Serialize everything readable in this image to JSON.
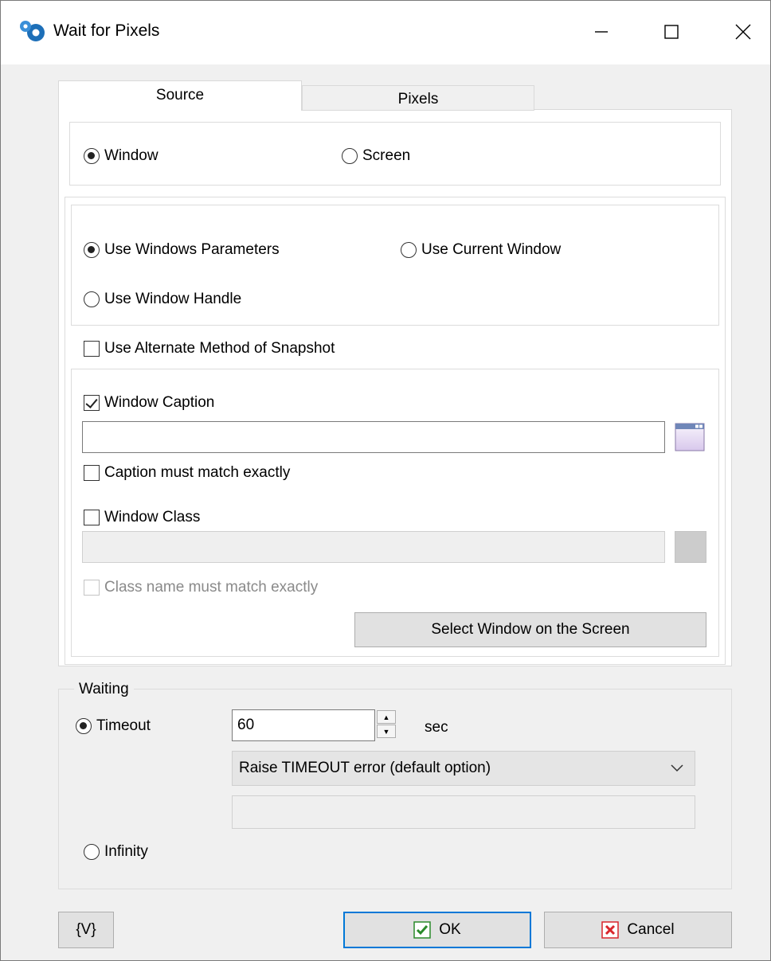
{
  "window": {
    "title": "Wait for Pixels",
    "icons": {
      "app": "app-gear-icon",
      "minimize": "minimize-icon",
      "maximize": "maximize-icon",
      "close": "close-icon"
    }
  },
  "tabs": [
    {
      "label": "Source",
      "active": true
    },
    {
      "label": "Pixels",
      "active": false
    }
  ],
  "source": {
    "window_radio": "Window",
    "screen_radio": "Screen",
    "use_windows_parameters": "Use Windows Parameters",
    "use_current_window": "Use Current Window",
    "use_window_handle": "Use Window Handle",
    "use_alternate_method": "Use Alternate Method of Snapshot",
    "window_caption": "Window Caption",
    "window_caption_value": "",
    "caption_match_exactly": "Caption must match exactly",
    "window_class": "Window Class",
    "window_class_value": "",
    "class_match_exactly": "Class name must match exactly",
    "select_window_button": "Select Window on the Screen"
  },
  "waiting": {
    "legend": "Waiting",
    "timeout_label": "Timeout",
    "timeout_value": "60",
    "unit": "sec",
    "timeout_action": "Raise TIMEOUT error (default option)",
    "extra_value": "",
    "infinity_label": "Infinity"
  },
  "footer": {
    "variables_button": "{V}",
    "ok_button": "OK",
    "cancel_button": "Cancel"
  },
  "colors": {
    "accent": "#0078d7",
    "ok_check": "#2a8a2a",
    "cancel_x": "#d9262c"
  }
}
